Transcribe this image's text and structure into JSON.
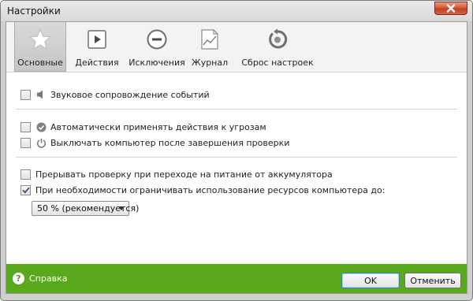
{
  "window": {
    "title": "Настройки"
  },
  "tabs": [
    {
      "label": "Основные",
      "icon": "star-icon",
      "active": true
    },
    {
      "label": "Действия",
      "icon": "play-icon",
      "active": false
    },
    {
      "label": "Исключения",
      "icon": "minus-circle-icon",
      "active": false
    },
    {
      "label": "Журнал",
      "icon": "chart-icon",
      "active": false
    },
    {
      "label": "Сброс настроек",
      "icon": "reset-icon",
      "active": false
    }
  ],
  "settings": {
    "sound": {
      "label": "Звуковое сопровождение событий",
      "checked": false,
      "icon": "speaker-icon"
    },
    "auto_actions": {
      "label": "Автоматически применять действия к угрозам",
      "checked": false,
      "icon": "check-circle-icon"
    },
    "shutdown": {
      "label": "Выключать компьютер после завершения проверки",
      "checked": false,
      "icon": "power-icon"
    },
    "battery": {
      "label": "Прерывать проверку при переходе на питание от аккумулятора",
      "checked": false
    },
    "limit_resources": {
      "label": "При необходимости ограничивать использование ресурсов компьютера до:",
      "checked": true
    },
    "resource_limit": {
      "value": "50 % (рекомендуется)"
    }
  },
  "footer": {
    "help_label": "Справка",
    "ok_label": "OK",
    "cancel_label": "Отменить"
  },
  "colors": {
    "footer_green": "#5aa81b",
    "close_red": "#c8462a"
  }
}
